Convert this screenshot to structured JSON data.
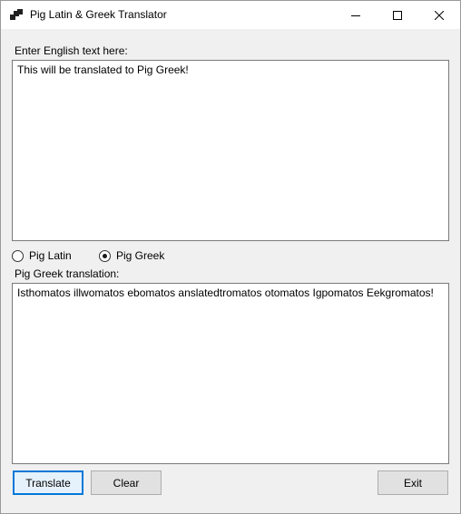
{
  "window": {
    "title": "Pig Latin & Greek Translator"
  },
  "input": {
    "label": "Enter English text here:",
    "value": "This will be translated to Pig Greek!"
  },
  "mode": {
    "options": [
      {
        "label": "Pig Latin",
        "selected": false
      },
      {
        "label": "Pig Greek",
        "selected": true
      }
    ]
  },
  "output": {
    "label": "Pig Greek translation:",
    "value": "Isthomatos illwomatos ebomatos anslatedtromatos otomatos Igpomatos Eekgromatos!"
  },
  "buttons": {
    "translate": "Translate",
    "clear": "Clear",
    "exit": "Exit"
  }
}
